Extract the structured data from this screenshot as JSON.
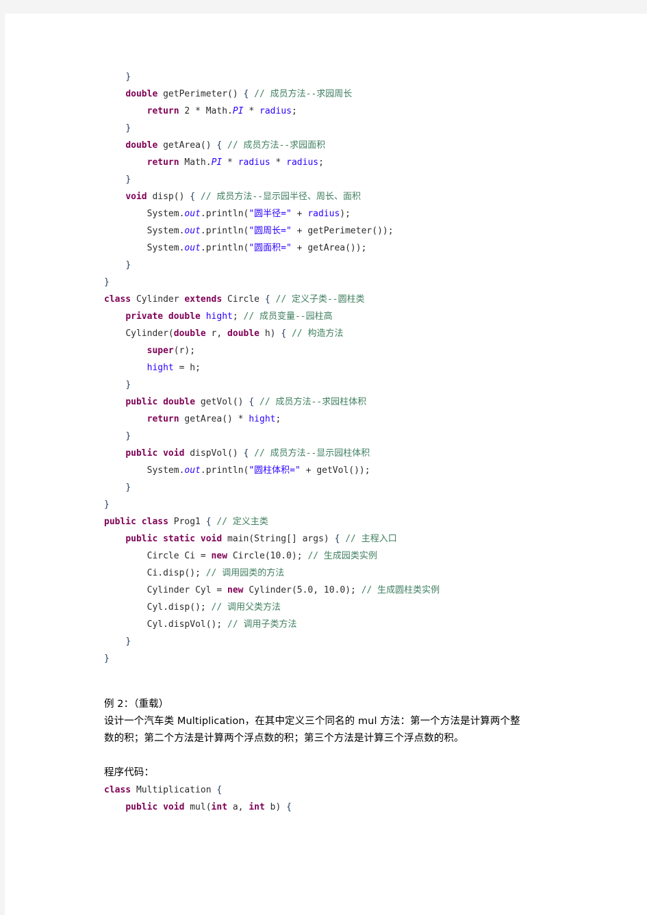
{
  "document": {
    "page_background": "#ffffff",
    "gutter_color": "#f4f4f4",
    "syntax_colors": {
      "keyword": "#7f0055",
      "comment": "#3f7f5f",
      "string": "#2a00ff",
      "field": "#2a00ff",
      "plain": "#2b2b2b",
      "brace": "#1f3a5f"
    }
  },
  "code_block_1": {
    "language": "java",
    "lines": [
      {
        "indent": 1,
        "tokens": [
          {
            "t": "}",
            "c": "brc"
          }
        ]
      },
      {
        "indent": 1,
        "tokens": [
          {
            "t": "double",
            "c": "kw"
          },
          {
            "t": " getPerimeter() ",
            "c": "pln"
          },
          {
            "t": "{",
            "c": "brc"
          },
          {
            "t": " ",
            "c": "pln"
          },
          {
            "t": "// 成员方法--求园周长",
            "c": "cmt"
          }
        ]
      },
      {
        "indent": 2,
        "tokens": [
          {
            "t": "return",
            "c": "kw"
          },
          {
            "t": " 2 * Math.",
            "c": "pln"
          },
          {
            "t": "PI",
            "c": "sfld"
          },
          {
            "t": " * ",
            "c": "pln"
          },
          {
            "t": "radius",
            "c": "fld"
          },
          {
            "t": ";",
            "c": "pln"
          }
        ]
      },
      {
        "indent": 1,
        "tokens": [
          {
            "t": "}",
            "c": "brc"
          }
        ]
      },
      {
        "indent": 1,
        "tokens": [
          {
            "t": "double",
            "c": "kw"
          },
          {
            "t": " getArea() ",
            "c": "pln"
          },
          {
            "t": "{",
            "c": "brc"
          },
          {
            "t": " ",
            "c": "pln"
          },
          {
            "t": "// 成员方法--求园面积",
            "c": "cmt"
          }
        ]
      },
      {
        "indent": 2,
        "tokens": [
          {
            "t": "return",
            "c": "kw"
          },
          {
            "t": " Math.",
            "c": "pln"
          },
          {
            "t": "PI",
            "c": "sfld"
          },
          {
            "t": " * ",
            "c": "pln"
          },
          {
            "t": "radius",
            "c": "fld"
          },
          {
            "t": " * ",
            "c": "pln"
          },
          {
            "t": "radius",
            "c": "fld"
          },
          {
            "t": ";",
            "c": "pln"
          }
        ]
      },
      {
        "indent": 1,
        "tokens": [
          {
            "t": "}",
            "c": "brc"
          }
        ]
      },
      {
        "indent": 1,
        "tokens": [
          {
            "t": "void",
            "c": "kw"
          },
          {
            "t": " disp() ",
            "c": "pln"
          },
          {
            "t": "{",
            "c": "brc"
          },
          {
            "t": " ",
            "c": "pln"
          },
          {
            "t": "// 成员方法--显示园半径、周长、面积",
            "c": "cmt"
          }
        ]
      },
      {
        "indent": 2,
        "tokens": [
          {
            "t": "System.",
            "c": "pln"
          },
          {
            "t": "out",
            "c": "sfld"
          },
          {
            "t": ".println(",
            "c": "pln"
          },
          {
            "t": "\"圆半径=\"",
            "c": "str"
          },
          {
            "t": " + ",
            "c": "pln"
          },
          {
            "t": "radius",
            "c": "fld"
          },
          {
            "t": ");",
            "c": "pln"
          }
        ]
      },
      {
        "indent": 2,
        "tokens": [
          {
            "t": "System.",
            "c": "pln"
          },
          {
            "t": "out",
            "c": "sfld"
          },
          {
            "t": ".println(",
            "c": "pln"
          },
          {
            "t": "\"圆周长=\"",
            "c": "str"
          },
          {
            "t": " + getPerimeter());",
            "c": "pln"
          }
        ]
      },
      {
        "indent": 2,
        "tokens": [
          {
            "t": "System.",
            "c": "pln"
          },
          {
            "t": "out",
            "c": "sfld"
          },
          {
            "t": ".println(",
            "c": "pln"
          },
          {
            "t": "\"圆面积=\"",
            "c": "str"
          },
          {
            "t": " + getArea());",
            "c": "pln"
          }
        ]
      },
      {
        "indent": 1,
        "tokens": [
          {
            "t": "}",
            "c": "brc"
          }
        ]
      },
      {
        "indent": 0,
        "tokens": [
          {
            "t": "}",
            "c": "brc"
          }
        ]
      },
      {
        "indent": 0,
        "tokens": [
          {
            "t": "class",
            "c": "kw"
          },
          {
            "t": " Cylinder ",
            "c": "pln"
          },
          {
            "t": "extends",
            "c": "kw"
          },
          {
            "t": " Circle ",
            "c": "pln"
          },
          {
            "t": "{",
            "c": "brc"
          },
          {
            "t": " ",
            "c": "pln"
          },
          {
            "t": "// 定义子类--圆柱类",
            "c": "cmt"
          }
        ]
      },
      {
        "indent": 1,
        "tokens": [
          {
            "t": "private double",
            "c": "kw"
          },
          {
            "t": " ",
            "c": "pln"
          },
          {
            "t": "hight",
            "c": "fld"
          },
          {
            "t": "; ",
            "c": "pln"
          },
          {
            "t": "// 成员变量--园柱高",
            "c": "cmt"
          }
        ]
      },
      {
        "indent": 1,
        "tokens": [
          {
            "t": "Cylinder(",
            "c": "pln"
          },
          {
            "t": "double",
            "c": "kw"
          },
          {
            "t": " r, ",
            "c": "pln"
          },
          {
            "t": "double",
            "c": "kw"
          },
          {
            "t": " h) ",
            "c": "pln"
          },
          {
            "t": "{",
            "c": "brc"
          },
          {
            "t": " ",
            "c": "pln"
          },
          {
            "t": "// 构造方法",
            "c": "cmt"
          }
        ]
      },
      {
        "indent": 2,
        "tokens": [
          {
            "t": "super",
            "c": "kw"
          },
          {
            "t": "(r);",
            "c": "pln"
          }
        ]
      },
      {
        "indent": 2,
        "tokens": [
          {
            "t": "hight",
            "c": "fld"
          },
          {
            "t": " = h;",
            "c": "pln"
          }
        ]
      },
      {
        "indent": 1,
        "tokens": [
          {
            "t": "}",
            "c": "brc"
          }
        ]
      },
      {
        "indent": 1,
        "tokens": [
          {
            "t": "public double",
            "c": "kw"
          },
          {
            "t": " getVol() ",
            "c": "pln"
          },
          {
            "t": "{",
            "c": "brc"
          },
          {
            "t": " ",
            "c": "pln"
          },
          {
            "t": "// 成员方法--求园柱体积",
            "c": "cmt"
          }
        ]
      },
      {
        "indent": 2,
        "tokens": [
          {
            "t": "return",
            "c": "kw"
          },
          {
            "t": " getArea() * ",
            "c": "pln"
          },
          {
            "t": "hight",
            "c": "fld"
          },
          {
            "t": ";",
            "c": "pln"
          }
        ]
      },
      {
        "indent": 1,
        "tokens": [
          {
            "t": "}",
            "c": "brc"
          }
        ]
      },
      {
        "indent": 1,
        "tokens": [
          {
            "t": "public void",
            "c": "kw"
          },
          {
            "t": " dispVol() ",
            "c": "pln"
          },
          {
            "t": "{",
            "c": "brc"
          },
          {
            "t": " ",
            "c": "pln"
          },
          {
            "t": "// 成员方法--显示园柱体积",
            "c": "cmt"
          }
        ]
      },
      {
        "indent": 2,
        "tokens": [
          {
            "t": "System.",
            "c": "pln"
          },
          {
            "t": "out",
            "c": "sfld"
          },
          {
            "t": ".println(",
            "c": "pln"
          },
          {
            "t": "\"圆柱体积=\"",
            "c": "str"
          },
          {
            "t": " + getVol());",
            "c": "pln"
          }
        ]
      },
      {
        "indent": 1,
        "tokens": [
          {
            "t": "}",
            "c": "brc"
          }
        ]
      },
      {
        "indent": 0,
        "tokens": [
          {
            "t": "}",
            "c": "brc"
          }
        ]
      },
      {
        "indent": 0,
        "tokens": [
          {
            "t": "public class",
            "c": "kw"
          },
          {
            "t": " Prog1 ",
            "c": "pln"
          },
          {
            "t": "{",
            "c": "brc"
          },
          {
            "t": " ",
            "c": "pln"
          },
          {
            "t": "// 定义主类",
            "c": "cmt"
          }
        ]
      },
      {
        "indent": 1,
        "tokens": [
          {
            "t": "public static void",
            "c": "kw"
          },
          {
            "t": " main(String[] args) ",
            "c": "pln"
          },
          {
            "t": "{",
            "c": "brc"
          },
          {
            "t": " ",
            "c": "pln"
          },
          {
            "t": "// 主程入口",
            "c": "cmt"
          }
        ]
      },
      {
        "indent": 2,
        "tokens": [
          {
            "t": "Circle Ci = ",
            "c": "pln"
          },
          {
            "t": "new",
            "c": "kw"
          },
          {
            "t": " Circle(10.0); ",
            "c": "pln"
          },
          {
            "t": "// 生成园类实例",
            "c": "cmt"
          }
        ]
      },
      {
        "indent": 2,
        "tokens": [
          {
            "t": "Ci.disp(); ",
            "c": "pln"
          },
          {
            "t": "// 调用园类的方法",
            "c": "cmt"
          }
        ]
      },
      {
        "indent": 2,
        "tokens": [
          {
            "t": "Cylinder Cyl = ",
            "c": "pln"
          },
          {
            "t": "new",
            "c": "kw"
          },
          {
            "t": " Cylinder(5.0, 10.0); ",
            "c": "pln"
          },
          {
            "t": "// 生成圆柱类实例",
            "c": "cmt"
          }
        ]
      },
      {
        "indent": 2,
        "tokens": [
          {
            "t": "Cyl.disp(); ",
            "c": "pln"
          },
          {
            "t": "// 调用父类方法",
            "c": "cmt"
          }
        ]
      },
      {
        "indent": 2,
        "tokens": [
          {
            "t": "Cyl.dispVol(); ",
            "c": "pln"
          },
          {
            "t": "// 调用子类方法",
            "c": "cmt"
          }
        ]
      },
      {
        "indent": 1,
        "tokens": [
          {
            "t": "}",
            "c": "brc"
          }
        ]
      },
      {
        "indent": 0,
        "tokens": [
          {
            "t": "}",
            "c": "brc"
          }
        ]
      }
    ]
  },
  "prose": {
    "example_heading": "例 2：（重载）",
    "description_line_1": "设计一个汽车类 Multiplication，在其中定义三个同名的 mul 方法：第一个方法是计算两个整",
    "description_line_2": "数的积；第二个方法是计算两个浮点数的积；第三个方法是计算三个浮点数的积。",
    "code_label": "程序代码："
  },
  "code_block_2": {
    "language": "java",
    "lines": [
      {
        "indent": 0,
        "tokens": [
          {
            "t": "class",
            "c": "kw"
          },
          {
            "t": " Multiplication ",
            "c": "pln"
          },
          {
            "t": "{",
            "c": "brc"
          }
        ]
      },
      {
        "indent": 1,
        "tokens": [
          {
            "t": "public void",
            "c": "kw"
          },
          {
            "t": " mul(",
            "c": "pln"
          },
          {
            "t": "int",
            "c": "kw"
          },
          {
            "t": " a, ",
            "c": "pln"
          },
          {
            "t": "int",
            "c": "kw"
          },
          {
            "t": " b) ",
            "c": "pln"
          },
          {
            "t": "{",
            "c": "brc"
          }
        ]
      }
    ]
  }
}
